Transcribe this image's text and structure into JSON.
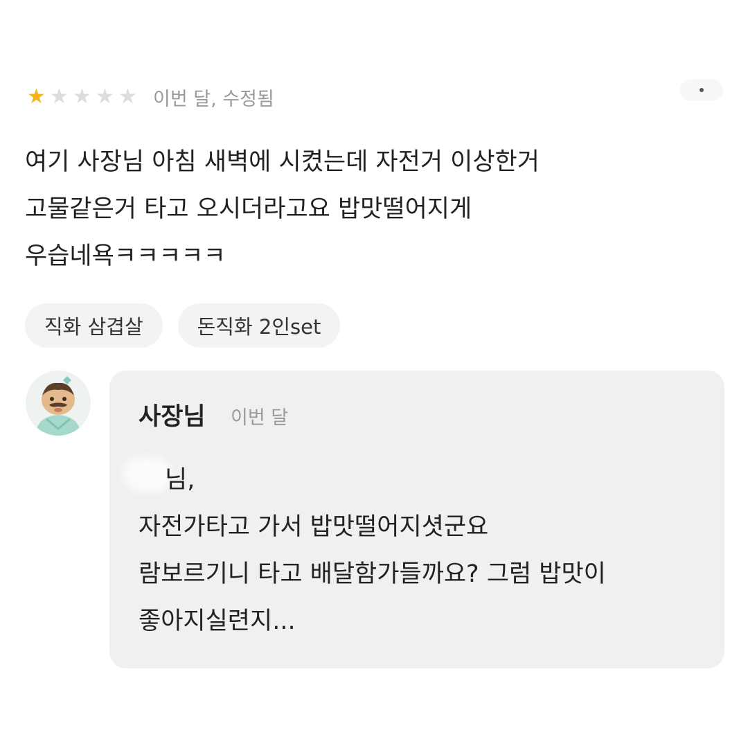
{
  "review": {
    "rating": 1,
    "max_rating": 5,
    "star_filled_color": "#f4b51a",
    "star_empty_color": "#dddddd",
    "meta": "이번 달, 수정됨",
    "text_lines": [
      "여기 사장님 아침 새벽에 시켰는데 자전거 이상한거",
      "고물같은거 타고 오시더라고요 밥맛떨어지게",
      "우습네욕ㅋㅋㅋㅋㅋ"
    ],
    "tags": [
      "직화 삼겹살",
      "돈직화 2인set"
    ]
  },
  "reply": {
    "author": "사장님",
    "date": "이번 달",
    "lines": [
      "님,",
      "자전가타고 가서 밥맛떨어지셧군요",
      "람보르기니 타고 배달함가들까요? 그럼 밥맛이",
      "좋아지실련지..."
    ]
  },
  "icons": {
    "more": "more-dots-icon",
    "avatar": "owner-avatar-icon"
  }
}
